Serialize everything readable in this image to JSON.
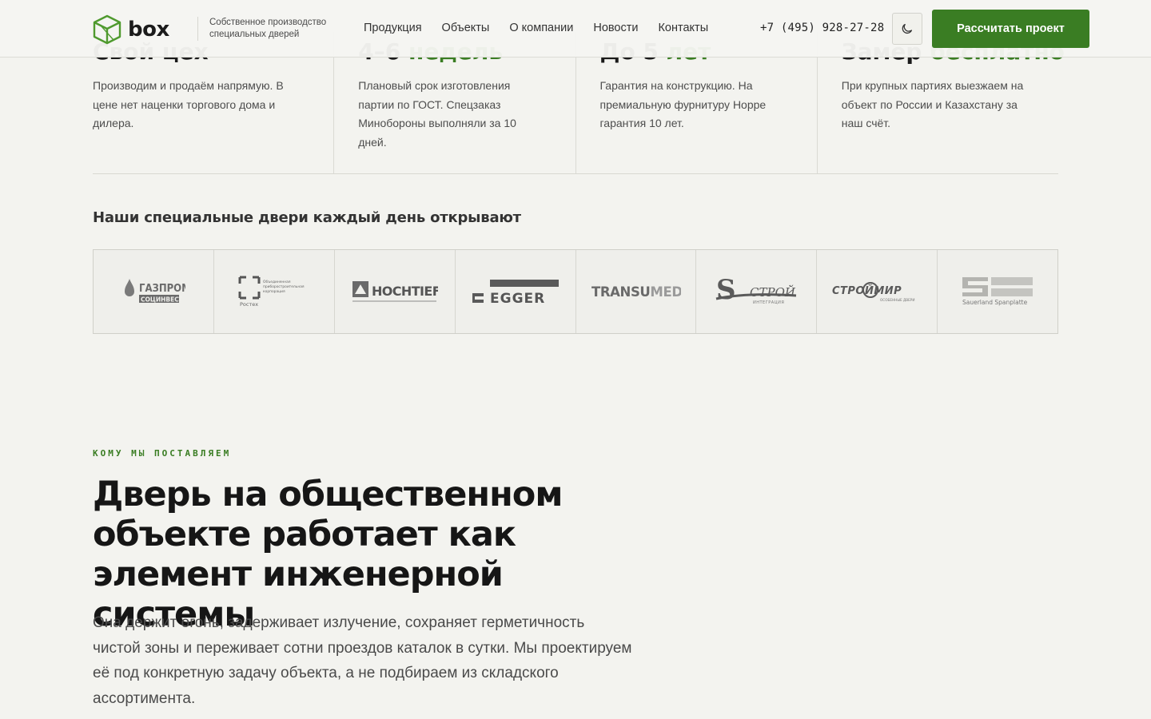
{
  "header": {
    "logo_text": "box",
    "tagline": "Собственное производство специальных дверей",
    "nav": [
      "Продукция",
      "Объекты",
      "О компании",
      "Новости",
      "Контакты"
    ],
    "phone": "+7 (495) 928-27-28",
    "cta_label": "Рассчитать проект"
  },
  "features": [
    {
      "title_prefix": "Свой цех",
      "title_accent": "",
      "text": "Производим и продаём напрямую. В цене нет наценки торгового дома и дилера."
    },
    {
      "title_prefix": "4–6 ",
      "title_accent": "недель",
      "text": "Плановый срок изготовления партии по ГОСТ. Спецзаказ Минобороны выполняли за 10 дней."
    },
    {
      "title_prefix": "До 5 ",
      "title_accent": "лет",
      "text": "Гарантия на конструкцию. На премиальную фурнитуру Hoppe гарантия 10 лет."
    },
    {
      "title_prefix": "Замер ",
      "title_accent": "бесплатно",
      "text": "При крупных партиях выезжаем на объект по России и Казахстану за наш счёт."
    }
  ],
  "partners": {
    "title": "Наши специальные двери каждый день открывают",
    "logos": [
      {
        "name": "gazprom",
        "line1": "ГАЗПРОМ",
        "line2": "СОЦИНВЕСТ"
      },
      {
        "name": "rostec",
        "line1": "Объединенная приборостроительная корпорация",
        "line2": "Ростех"
      },
      {
        "name": "hochtief",
        "line1": "HOCHTIEF"
      },
      {
        "name": "egger",
        "line1": "EGGER"
      },
      {
        "name": "transumed",
        "line1": "TRANSU",
        "line2": "MED"
      },
      {
        "name": "sstroy",
        "line1": "СТРОЙ",
        "line2": "ИНТЕГРАЦИЯ"
      },
      {
        "name": "stroymir",
        "line1": "СТРОЙМИР",
        "line2": "ОСОБЕННЫЕ ДВЕРИ"
      },
      {
        "name": "sauerland",
        "line1": "Sauerland Spanplatte"
      }
    ]
  },
  "section": {
    "eyebrow": "КОМУ МЫ ПОСТАВЛЯЕМ",
    "title": "Дверь на общественном объекте работает как элемент инженерной системы",
    "text": "Она держит огонь, задерживает излучение, сохраняет герметичность чистой зоны и переживает сотни проездов каталок в сутки. Мы проектируем её под конкретную задачу объекта, а не подбираем из складского ассортимента."
  },
  "colors": {
    "accent": "#3a7d23",
    "background": "#f3f3ef"
  }
}
